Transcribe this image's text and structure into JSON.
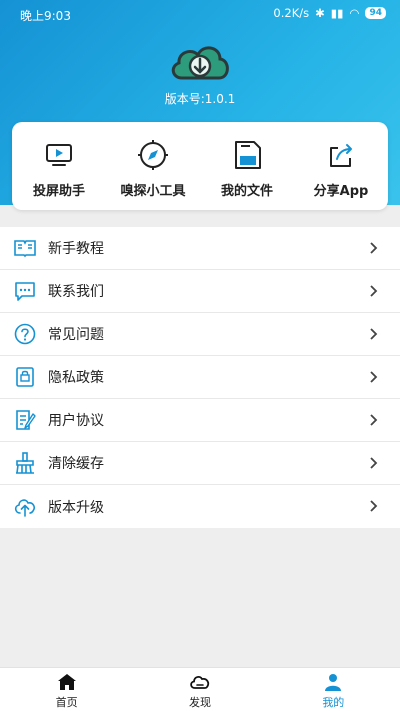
{
  "status": {
    "time": "晚上9:03",
    "speed": "0.2K/s",
    "battery": "94"
  },
  "app": {
    "version": "版本号:1.0.1"
  },
  "tools": [
    {
      "label": "投屏助手",
      "icon": "screen-cast-icon"
    },
    {
      "label": "嗅探小工具",
      "icon": "compass-icon"
    },
    {
      "label": "我的文件",
      "icon": "folder-file-icon"
    },
    {
      "label": "分享App",
      "icon": "share-icon"
    }
  ],
  "menu": [
    {
      "label": "新手教程",
      "icon": "book-icon"
    },
    {
      "label": "联系我们",
      "icon": "chat-icon"
    },
    {
      "label": "常见问题",
      "icon": "question-icon"
    },
    {
      "label": "隐私政策",
      "icon": "privacy-icon"
    },
    {
      "label": "用户协议",
      "icon": "agreement-icon"
    },
    {
      "label": "清除缓存",
      "icon": "clear-cache-icon"
    },
    {
      "label": "版本升级",
      "icon": "upgrade-icon"
    }
  ],
  "nav": [
    {
      "label": "首页",
      "icon": "home-icon"
    },
    {
      "label": "发现",
      "icon": "cloud-icon"
    },
    {
      "label": "我的",
      "icon": "user-icon"
    }
  ],
  "colors": {
    "accent": "#1592d4",
    "header_light": "#39c3ec"
  }
}
